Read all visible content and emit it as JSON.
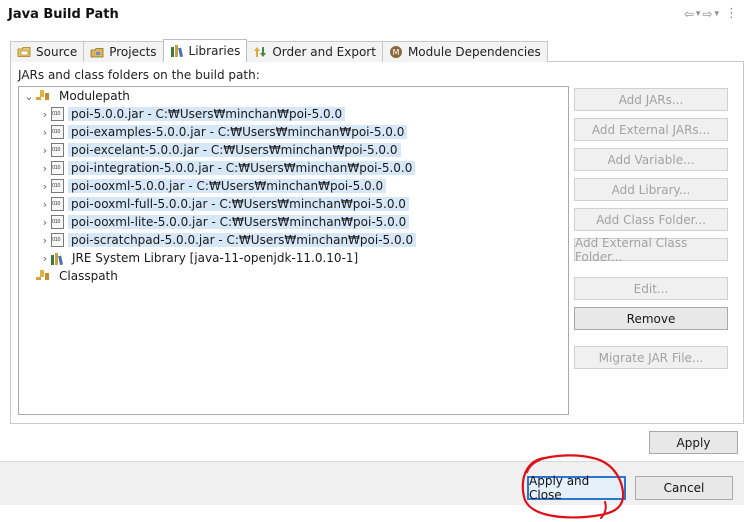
{
  "window": {
    "title": "Java Build Path"
  },
  "tabs": [
    {
      "label": "Source",
      "icon": "source-folder-icon",
      "active": false
    },
    {
      "label": "Projects",
      "icon": "projects-icon",
      "active": false
    },
    {
      "label": "Libraries",
      "icon": "libraries-icon",
      "active": true
    },
    {
      "label": "Order and Export",
      "icon": "order-export-icon",
      "active": false
    },
    {
      "label": "Module Dependencies",
      "icon": "module-dependencies-icon",
      "active": false
    }
  ],
  "libraries": {
    "label": "JARs and class folders on the build path:",
    "modulepath": {
      "label": "Modulepath",
      "items": [
        {
          "label": "poi-5.0.0.jar - C:₩Users₩minchan₩poi-5.0.0"
        },
        {
          "label": "poi-examples-5.0.0.jar - C:₩Users₩minchan₩poi-5.0.0"
        },
        {
          "label": "poi-excelant-5.0.0.jar - C:₩Users₩minchan₩poi-5.0.0"
        },
        {
          "label": "poi-integration-5.0.0.jar - C:₩Users₩minchan₩poi-5.0.0"
        },
        {
          "label": "poi-ooxml-5.0.0.jar - C:₩Users₩minchan₩poi-5.0.0"
        },
        {
          "label": "poi-ooxml-full-5.0.0.jar - C:₩Users₩minchan₩poi-5.0.0"
        },
        {
          "label": "poi-ooxml-lite-5.0.0.jar - C:₩Users₩minchan₩poi-5.0.0"
        },
        {
          "label": "poi-scratchpad-5.0.0.jar - C:₩Users₩minchan₩poi-5.0.0"
        }
      ],
      "jre": {
        "label": "JRE System Library [java-11-openjdk-11.0.10-1]"
      }
    },
    "classpath": {
      "label": "Classpath"
    }
  },
  "buttons": {
    "add_jars": "Add JARs...",
    "add_external_jars": "Add External JARs...",
    "add_variable": "Add Variable...",
    "add_library": "Add Library...",
    "add_class_folder": "Add Class Folder...",
    "add_external_class_folder": "Add External Class Folder...",
    "edit": "Edit...",
    "remove": "Remove",
    "migrate_jar": "Migrate JAR File...",
    "apply": "Apply",
    "apply_and_close": "Apply and Close",
    "cancel": "Cancel"
  },
  "colors": {
    "selection": "#d6e7f8",
    "focus_border": "#2a76d3",
    "annotation": "#e0101a"
  }
}
